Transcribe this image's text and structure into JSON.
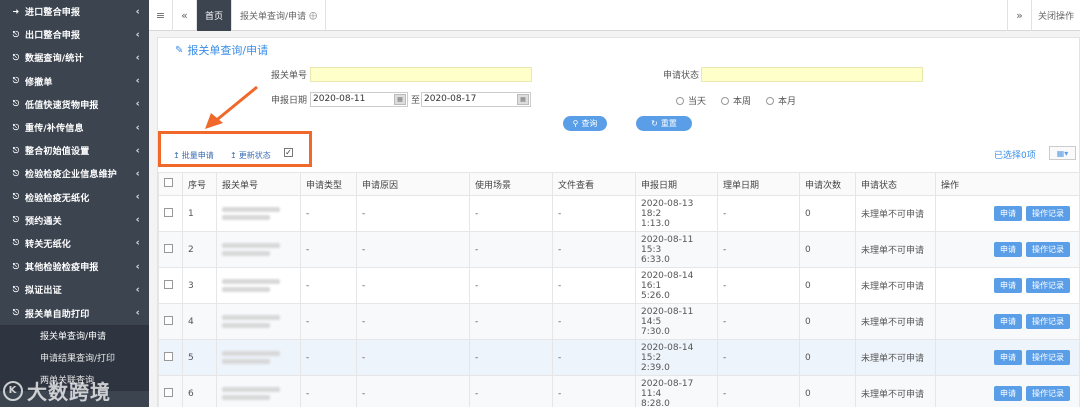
{
  "sidebar": {
    "items": [
      {
        "label": "进口整合申报",
        "icon": "sign-in-icon"
      },
      {
        "label": "出口整合申报",
        "icon": "sign-out-icon"
      },
      {
        "label": "数据查询/统计",
        "icon": "sign-out-icon"
      },
      {
        "label": "修撤单",
        "icon": "sign-out-icon"
      },
      {
        "label": "低值快速货物申报",
        "icon": "sign-out-icon"
      },
      {
        "label": "重传/补传信息",
        "icon": "sign-out-icon"
      },
      {
        "label": "整合初始值设置",
        "icon": "sign-out-icon"
      },
      {
        "label": "检验检疫企业信息维护",
        "icon": "sign-out-icon"
      },
      {
        "label": "检验检疫无纸化",
        "icon": "sign-out-icon"
      },
      {
        "label": "预约通关",
        "icon": "sign-out-icon"
      },
      {
        "label": "转关无纸化",
        "icon": "sign-out-icon"
      },
      {
        "label": "其他检验检疫申报",
        "icon": "sign-out-icon"
      },
      {
        "label": "拟证出证",
        "icon": "sign-out-icon"
      },
      {
        "label": "报关单自助打印",
        "icon": "sign-out-icon"
      }
    ],
    "subitems": [
      "报关单查询/申请",
      "申请结果查询/打印",
      "两单关联查询"
    ]
  },
  "topbar": {
    "home_tab": "首页",
    "active_tab": "报关单查询/申请",
    "close_ops": "关闭操作"
  },
  "page": {
    "title": "报关单查询/申请"
  },
  "form": {
    "decl_no_label": "报关单号",
    "status_label": "申请状态",
    "date_label": "申报日期",
    "date_from": "2020-08-11",
    "date_sep": "至",
    "date_to": "2020-08-17",
    "radio_today": "当天",
    "radio_week": "本周",
    "radio_month": "本月",
    "search_btn": "查询",
    "reset_btn": "重置"
  },
  "toolbar": {
    "batch_apply": "批量申请",
    "update_status": "更新状态",
    "selected": "已选择0项"
  },
  "table": {
    "headers": [
      "",
      "序号",
      "报关单号",
      "申请类型",
      "申请原因",
      "使用场景",
      "文件查看",
      "申报日期",
      "理单日期",
      "申请次数",
      "申请状态",
      "操作"
    ],
    "rows": [
      {
        "no": "1",
        "type": "-",
        "reason": "-",
        "scene": "-",
        "file": "-",
        "date1": "2020-08-13 18:2",
        "date2": "1:13.0",
        "tidy": "-",
        "count": "0",
        "status": "未理单不可申请"
      },
      {
        "no": "2",
        "type": "-",
        "reason": "-",
        "scene": "-",
        "file": "-",
        "date1": "2020-08-11 15:3",
        "date2": "6:33.0",
        "tidy": "-",
        "count": "0",
        "status": "未理单不可申请"
      },
      {
        "no": "3",
        "type": "-",
        "reason": "-",
        "scene": "-",
        "file": "-",
        "date1": "2020-08-14 16:1",
        "date2": "5:26.0",
        "tidy": "-",
        "count": "0",
        "status": "未理单不可申请"
      },
      {
        "no": "4",
        "type": "-",
        "reason": "-",
        "scene": "-",
        "file": "-",
        "date1": "2020-08-11 14:5",
        "date2": "7:30.0",
        "tidy": "-",
        "count": "0",
        "status": "未理单不可申请"
      },
      {
        "no": "5",
        "type": "-",
        "reason": "-",
        "scene": "-",
        "file": "-",
        "date1": "2020-08-14 15:2",
        "date2": "2:39.0",
        "tidy": "-",
        "count": "0",
        "status": "未理单不可申请"
      },
      {
        "no": "6",
        "type": "-",
        "reason": "-",
        "scene": "-",
        "file": "-",
        "date1": "2020-08-17 11:4",
        "date2": "8:28.0",
        "tidy": "-",
        "count": "0",
        "status": "未理单不可申请"
      }
    ],
    "apply_btn": "申请",
    "log_btn": "操作记录"
  },
  "watermark": {
    "text": "大数跨境"
  },
  "colors": {
    "sidebar_bg": "#3c4450",
    "accent": "#5a9ee8",
    "highlight_input": "#ffffc9",
    "annotation": "#f0682a"
  }
}
